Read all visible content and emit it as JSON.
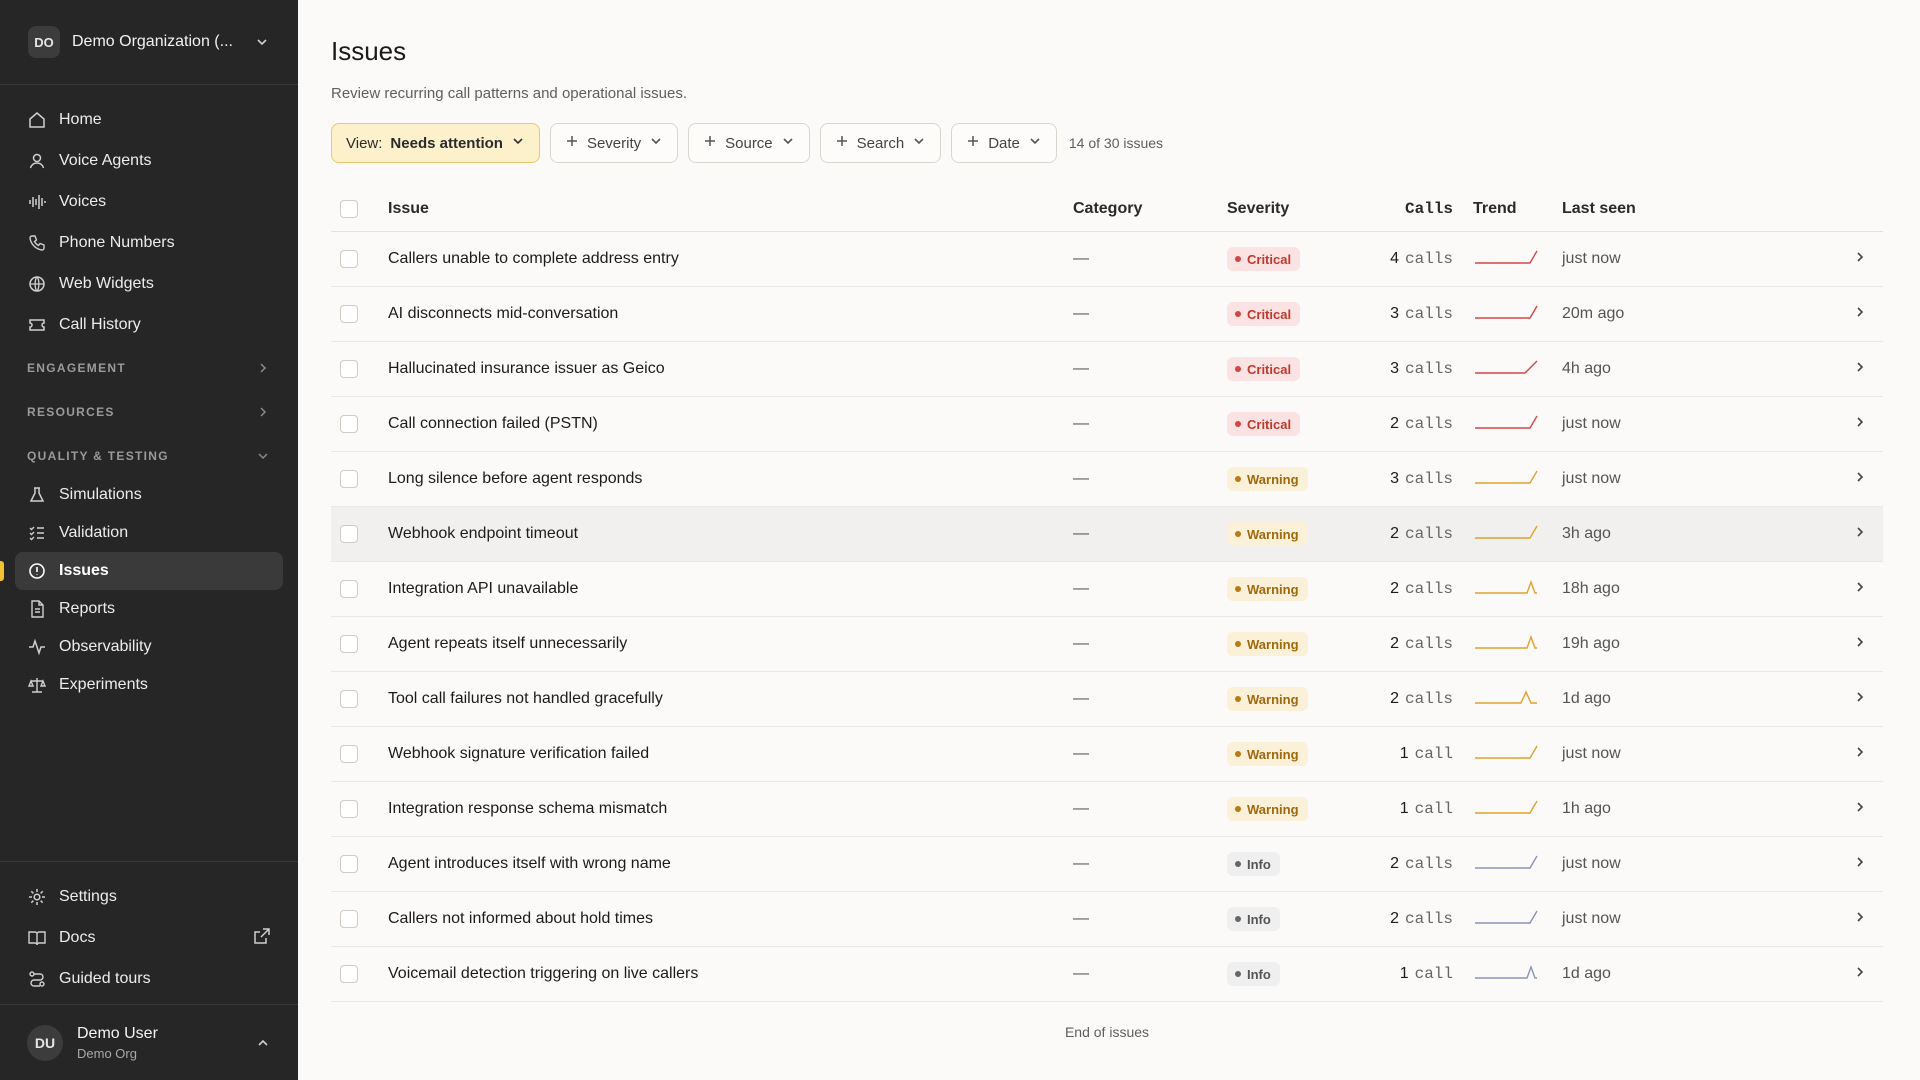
{
  "org": {
    "initials": "DO",
    "name": "Demo Organization (..."
  },
  "nav": {
    "main": [
      {
        "label": "Home",
        "icon": "home-icon"
      },
      {
        "label": "Voice Agents",
        "icon": "user-icon"
      },
      {
        "label": "Voices",
        "icon": "waveform-icon"
      },
      {
        "label": "Phone Numbers",
        "icon": "phone-icon"
      },
      {
        "label": "Web Widgets",
        "icon": "globe-icon"
      },
      {
        "label": "Call History",
        "icon": "ticket-icon"
      }
    ],
    "engagement": "ENGAGEMENT",
    "resources": "RESOURCES",
    "quality": "QUALITY & TESTING",
    "quality_items": [
      {
        "label": "Simulations",
        "icon": "flask-icon"
      },
      {
        "label": "Validation",
        "icon": "checklist-icon"
      },
      {
        "label": "Issues",
        "icon": "alert-circle-icon"
      },
      {
        "label": "Reports",
        "icon": "document-icon"
      },
      {
        "label": "Observability",
        "icon": "activity-icon"
      },
      {
        "label": "Experiments",
        "icon": "scale-icon"
      }
    ],
    "bottom": [
      {
        "label": "Settings",
        "icon": "gear-icon"
      },
      {
        "label": "Docs",
        "icon": "book-icon"
      },
      {
        "label": "Guided tours",
        "icon": "route-icon"
      }
    ]
  },
  "user": {
    "initials": "DU",
    "name": "Demo User",
    "org": "Demo Org"
  },
  "page": {
    "title": "Issues",
    "subtitle": "Review recurring call patterns and operational issues."
  },
  "filters": {
    "view_prefix": "View:",
    "view_value": "Needs attention",
    "severity": "Severity",
    "source": "Source",
    "search": "Search",
    "date": "Date",
    "count": "14 of 30 issues"
  },
  "table": {
    "headers": {
      "issue": "Issue",
      "category": "Category",
      "severity": "Severity",
      "calls": "Calls",
      "trend": "Trend",
      "last_seen": "Last seen"
    },
    "rows": [
      {
        "issue": "Callers unable to complete address entry",
        "category": "—",
        "severity": "Critical",
        "calls": "4",
        "unit": "calls",
        "trend": "rise",
        "last_seen": "just now"
      },
      {
        "issue": "AI disconnects mid-conversation",
        "category": "—",
        "severity": "Critical",
        "calls": "3",
        "unit": "calls",
        "trend": "rise",
        "last_seen": "20m ago"
      },
      {
        "issue": "Hallucinated insurance issuer as Geico",
        "category": "—",
        "severity": "Critical",
        "calls": "3",
        "unit": "calls",
        "trend": "rise-early",
        "last_seen": "4h ago"
      },
      {
        "issue": "Call connection failed (PSTN)",
        "category": "—",
        "severity": "Critical",
        "calls": "2",
        "unit": "calls",
        "trend": "rise",
        "last_seen": "just now"
      },
      {
        "issue": "Long silence before agent responds",
        "category": "—",
        "severity": "Warning",
        "calls": "3",
        "unit": "calls",
        "trend": "rise",
        "last_seen": "just now"
      },
      {
        "issue": "Webhook endpoint timeout",
        "category": "—",
        "severity": "Warning",
        "calls": "2",
        "unit": "calls",
        "trend": "rise",
        "last_seen": "3h ago"
      },
      {
        "issue": "Integration API unavailable",
        "category": "—",
        "severity": "Warning",
        "calls": "2",
        "unit": "calls",
        "trend": "spike-end",
        "last_seen": "18h ago"
      },
      {
        "issue": "Agent repeats itself unnecessarily",
        "category": "—",
        "severity": "Warning",
        "calls": "2",
        "unit": "calls",
        "trend": "spike-end",
        "last_seen": "19h ago"
      },
      {
        "issue": "Tool call failures not handled gracefully",
        "category": "—",
        "severity": "Warning",
        "calls": "2",
        "unit": "calls",
        "trend": "spike-mid",
        "last_seen": "1d ago"
      },
      {
        "issue": "Webhook signature verification failed",
        "category": "—",
        "severity": "Warning",
        "calls": "1",
        "unit": "call",
        "trend": "rise",
        "last_seen": "just now"
      },
      {
        "issue": "Integration response schema mismatch",
        "category": "—",
        "severity": "Warning",
        "calls": "1",
        "unit": "call",
        "trend": "rise",
        "last_seen": "1h ago"
      },
      {
        "issue": "Agent introduces itself with wrong name",
        "category": "—",
        "severity": "Info",
        "calls": "2",
        "unit": "calls",
        "trend": "rise",
        "last_seen": "just now"
      },
      {
        "issue": "Callers not informed about hold times",
        "category": "—",
        "severity": "Info",
        "calls": "2",
        "unit": "calls",
        "trend": "rise",
        "last_seen": "just now"
      },
      {
        "issue": "Voicemail detection triggering on live callers",
        "category": "—",
        "severity": "Info",
        "calls": "1",
        "unit": "call",
        "trend": "spike-end",
        "last_seen": "1d ago"
      }
    ],
    "end": "End of issues"
  },
  "colors": {
    "critical": "#d64545",
    "warning": "#e0a12e",
    "info": "#8a93b8",
    "accent": "#f2c230"
  }
}
